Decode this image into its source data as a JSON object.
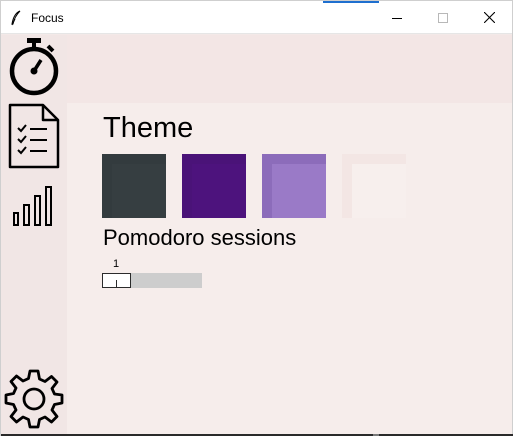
{
  "window": {
    "title": "Focus",
    "icon": "feather-icon",
    "controls": [
      "minimize-icon",
      "maximize-icon",
      "close-icon"
    ]
  },
  "sidebar": {
    "items": [
      {
        "name": "timer",
        "icon": "stopwatch-icon"
      },
      {
        "name": "tasks",
        "icon": "checklist-document-icon"
      },
      {
        "name": "statistics",
        "icon": "bar-chart-icon"
      },
      {
        "name": "settings",
        "icon": "gear-icon"
      }
    ]
  },
  "settings": {
    "theme_heading": "Theme",
    "themes": [
      {
        "name": "dark",
        "color": "#333b3e"
      },
      {
        "name": "purple",
        "color": "#4a1378"
      },
      {
        "name": "lavender",
        "color": "#8c6cba"
      },
      {
        "name": "light",
        "color": "#f3e6e4"
      }
    ],
    "pomodoro_heading": "Pomodoro sessions",
    "pomodoro_sessions": {
      "value": "1",
      "min": 1,
      "max": 4
    }
  },
  "colors": {
    "background": "#f3e9e8",
    "content_background": "#f6edeb",
    "slider_trough": "#cdcdcd"
  }
}
